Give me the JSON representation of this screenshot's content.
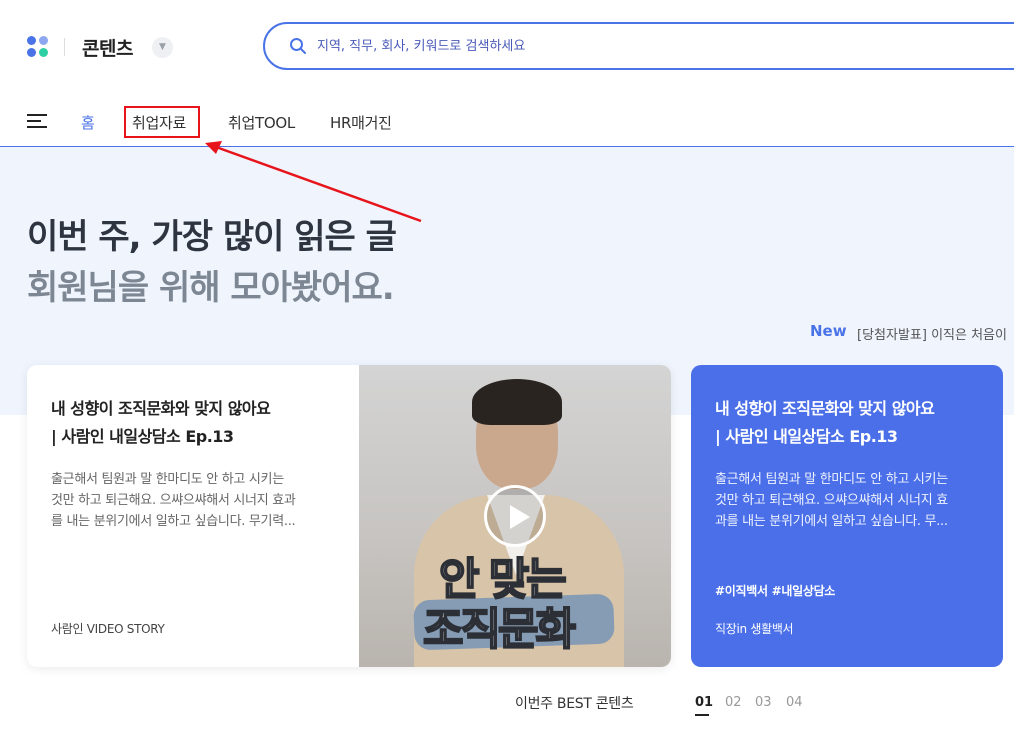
{
  "header": {
    "service_title": "콘텐츠",
    "search_placeholder": "지역, 직무, 회사, 키워드로 검색하세요"
  },
  "nav": {
    "items": [
      {
        "label": "홈",
        "active": true
      },
      {
        "label": "취업자료",
        "active": false,
        "highlighted": true
      },
      {
        "label": "취업TOOL",
        "active": false
      },
      {
        "label": "HR매거진",
        "active": false
      }
    ]
  },
  "hero": {
    "title": "이번 주, 가장 많이 읽은 글",
    "subtitle": "회원님을 위해 모아봤어요.",
    "new_badge": "New",
    "news_text": "[당첨자발표] 이직은 처음이"
  },
  "cards": [
    {
      "title_line1": "내 성향이 조직문화와 맞지 않아요",
      "title_line2": "| 사람인 내일상담소 Ep.13",
      "desc_lines": [
        "출근해서 팀원과 말 한마디도 안 하고 시키는",
        "것만 하고 퇴근해요. 으쌰으쌰해서 시너지 효과",
        "를 내는 분위기에서 일하고 싶습니다. 무기력..."
      ],
      "source": "사람인 VIDEO STORY",
      "thumb_text_line1": "안 맞는",
      "thumb_text_line2": "조직문화"
    },
    {
      "title_line1": "내 성향이 조직문화와 맞지 않아요",
      "title_line2": "| 사람인 내일상담소 Ep.13",
      "desc_lines": [
        "출근해서 팀원과 말 한마디도 안 하고 시키는",
        "것만 하고 퇴근해요. 으쌰으쌰해서 시너지 효",
        "과를 내는 분위기에서 일하고 싶습니다. 무..."
      ],
      "tags": "#이직백서 #내일상담소",
      "source": "직장in 생활백서"
    }
  ],
  "best": {
    "label": "이번주 BEST 콘텐츠",
    "pages": [
      "01",
      "02",
      "03",
      "04"
    ],
    "active_page": "01"
  },
  "colors": {
    "accent": "#4a73e8",
    "hero_bg": "#eff4fd",
    "highlight_red": "#e8141b"
  },
  "icons": {
    "logo": "dots-logo-icon",
    "search": "search-icon",
    "menu": "hamburger-menu-icon",
    "dropdown": "chevron-down-icon",
    "play": "play-icon"
  }
}
